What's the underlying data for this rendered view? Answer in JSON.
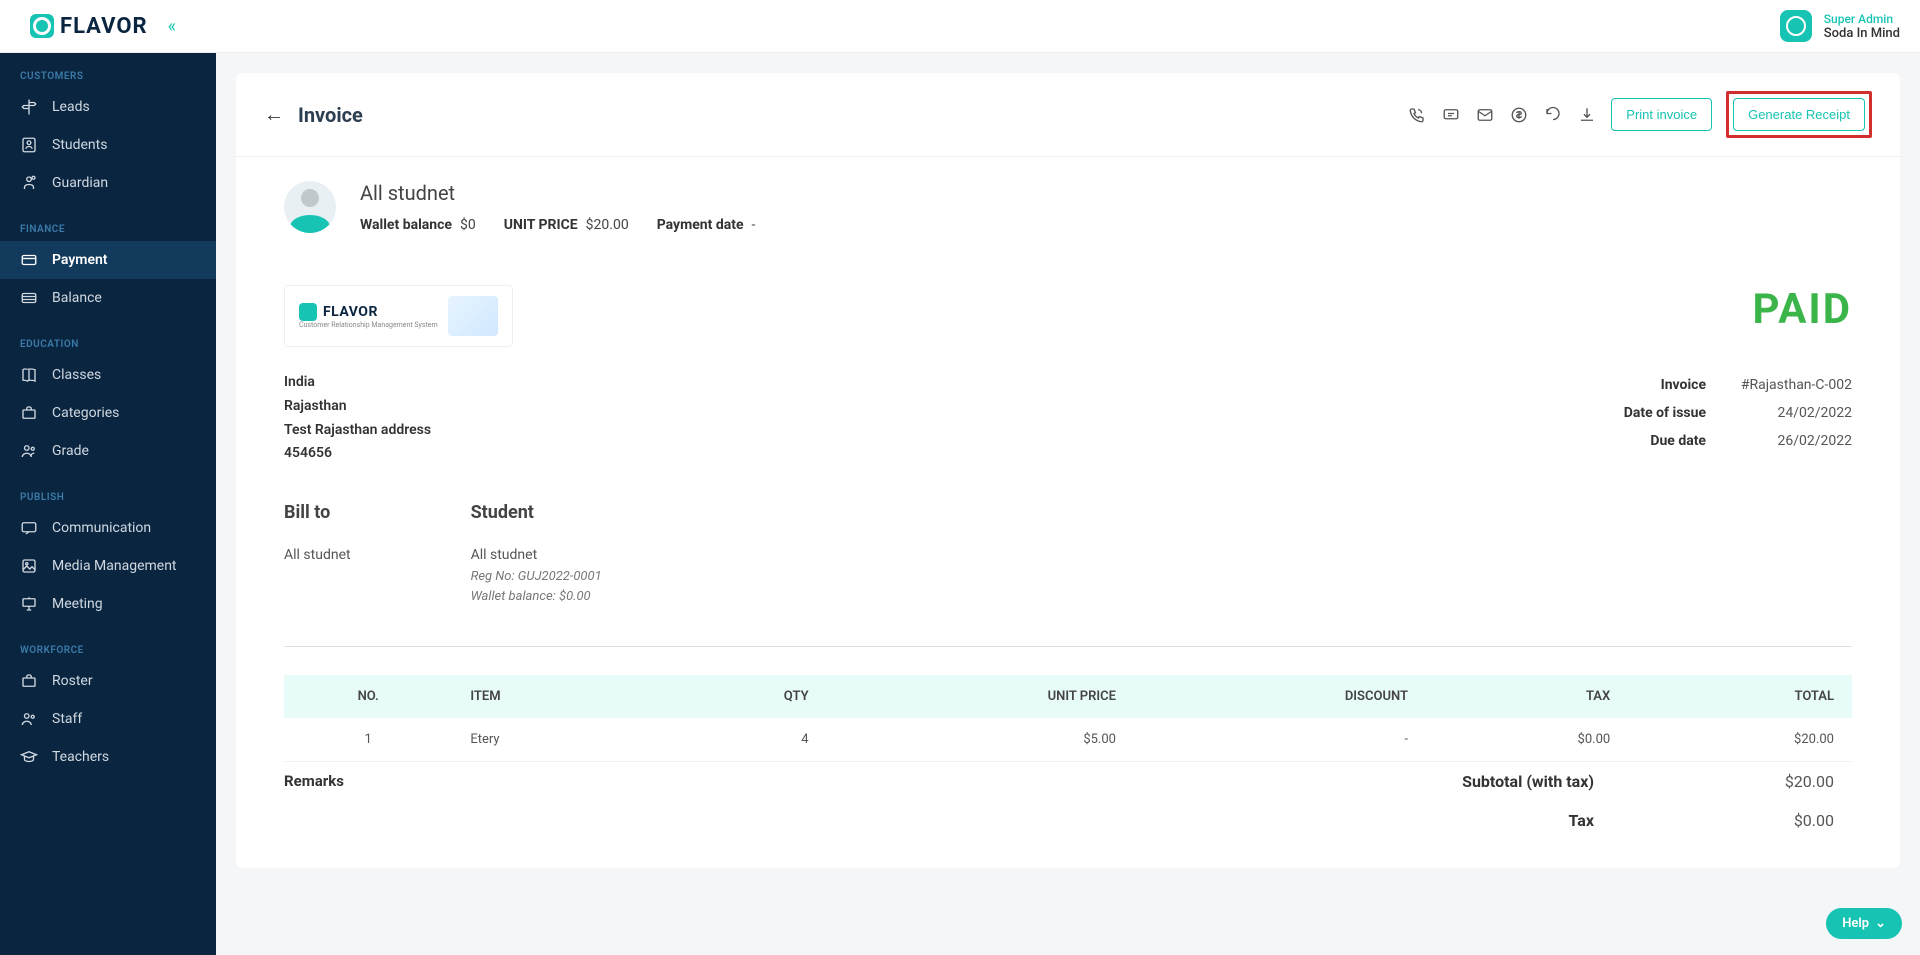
{
  "brand": {
    "name": "FLAVOR",
    "logo_sub": "Customer Relationship Management System"
  },
  "user": {
    "role": "Super Admin",
    "org": "Soda In Mind"
  },
  "sidebar": {
    "sections": [
      {
        "header": "CUSTOMERS",
        "items": [
          {
            "label": "Leads",
            "icon": "signpost"
          },
          {
            "label": "Students",
            "icon": "user"
          },
          {
            "label": "Guardian",
            "icon": "shield"
          }
        ]
      },
      {
        "header": "FINANCE",
        "items": [
          {
            "label": "Payment",
            "icon": "card",
            "active": true
          },
          {
            "label": "Balance",
            "icon": "wallet"
          }
        ]
      },
      {
        "header": "EDUCATION",
        "items": [
          {
            "label": "Classes",
            "icon": "book"
          },
          {
            "label": "Categories",
            "icon": "briefcase"
          },
          {
            "label": "Grade",
            "icon": "users"
          }
        ]
      },
      {
        "header": "PUBLISH",
        "items": [
          {
            "label": "Communication",
            "icon": "chat"
          },
          {
            "label": "Media Management",
            "icon": "image"
          },
          {
            "label": "Meeting",
            "icon": "present"
          }
        ]
      },
      {
        "header": "WORKFORCE",
        "items": [
          {
            "label": "Roster",
            "icon": "briefcase"
          },
          {
            "label": "Staff",
            "icon": "users"
          },
          {
            "label": "Teachers",
            "icon": "hat"
          }
        ]
      }
    ]
  },
  "page": {
    "title": "Invoice",
    "actions": {
      "print": "Print invoice",
      "receipt": "Generate Receipt"
    }
  },
  "summary": {
    "name": "All studnet",
    "wallet_label": "Wallet balance",
    "wallet_value": "$0",
    "unit_label": "UNIT PRICE",
    "unit_value": "$20.00",
    "date_label": "Payment date",
    "date_value": "-"
  },
  "invoice": {
    "status": "PAID",
    "address": {
      "country": "India",
      "state": "Rajasthan",
      "street": "Test Rajasthan address",
      "postal": "454656"
    },
    "details": [
      {
        "label": "Invoice",
        "value": "#Rajasthan-C-002"
      },
      {
        "label": "Date of issue",
        "value": "24/02/2022"
      },
      {
        "label": "Due date",
        "value": "26/02/2022"
      }
    ],
    "bill_to": {
      "title": "Bill to",
      "name": "All studnet"
    },
    "student": {
      "title": "Student",
      "name": "All studnet",
      "reg": "Reg No: GUJ2022-0001",
      "wallet": "Wallet balance: $0.00"
    },
    "table": {
      "headers": [
        "NO.",
        "ITEM",
        "QTY",
        "UNIT PRICE",
        "DISCOUNT",
        "TAX",
        "TOTAL"
      ],
      "rows": [
        {
          "no": "1",
          "item": "Etery",
          "qty": "4",
          "unit": "$5.00",
          "discount": "-",
          "tax": "$0.00",
          "total": "$20.00"
        }
      ]
    },
    "remarks_label": "Remarks",
    "totals": [
      {
        "label": "Subtotal (with tax)",
        "value": "$20.00"
      },
      {
        "label": "Tax",
        "value": "$0.00"
      }
    ]
  },
  "help": "Help"
}
